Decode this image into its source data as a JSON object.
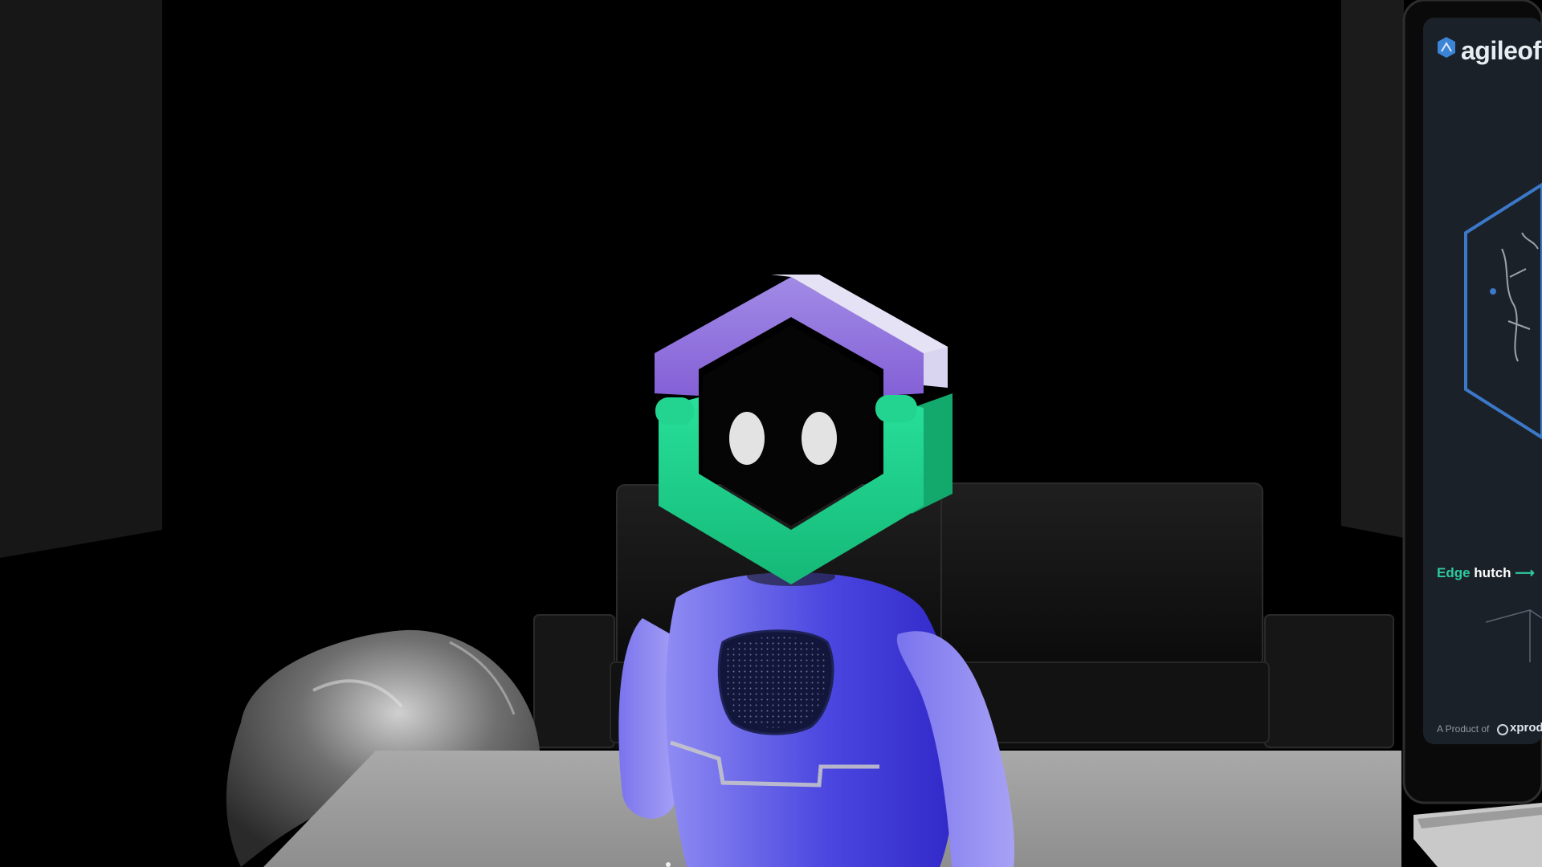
{
  "scene": {
    "background": "#000000",
    "robot_colors": {
      "helmet_top": "#9a7be0",
      "helmet_bottom": "#1ed98c",
      "body": "#6b64e6",
      "eyes": "#e4e4e4"
    }
  },
  "poster": {
    "brand_name": "agileoff",
    "caption_accent": "Edge",
    "caption_main": "hutch",
    "caption_arrow": "⟶",
    "footer_prefix": "A Product of",
    "footer_brand": "xprod"
  }
}
